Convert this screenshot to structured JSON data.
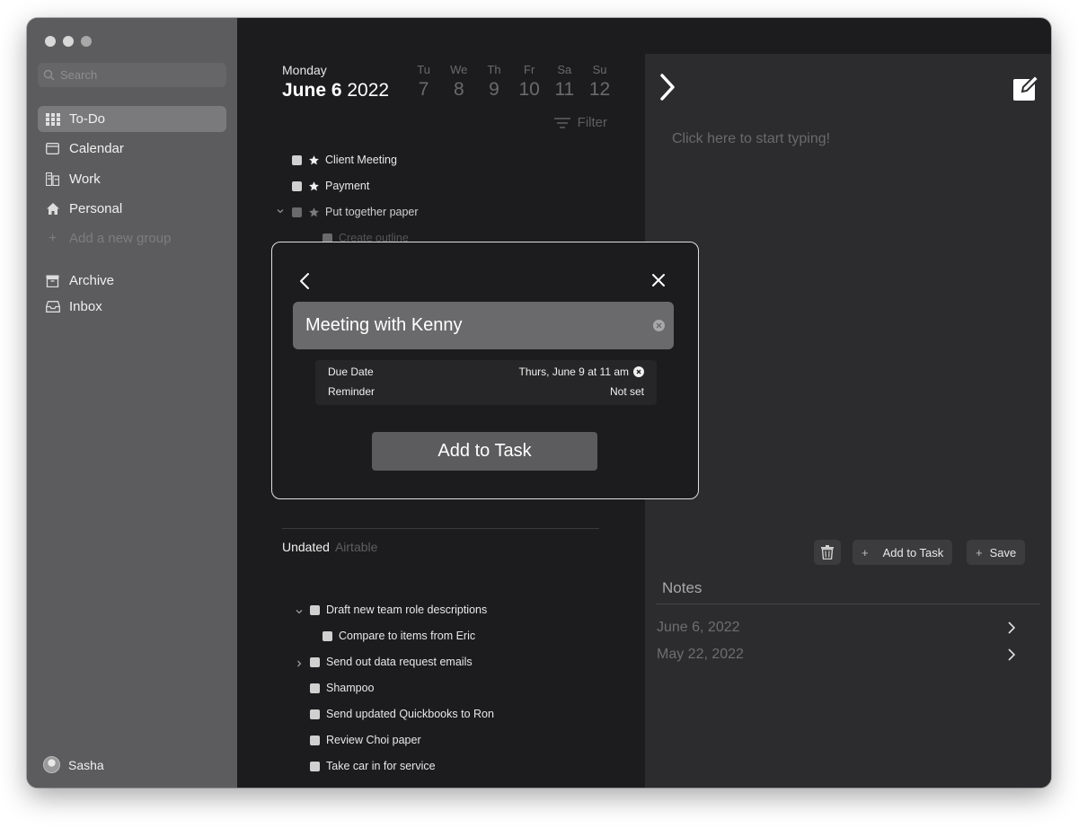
{
  "sidebar": {
    "search_placeholder": "Search",
    "items": [
      {
        "label": "To-Do"
      },
      {
        "label": "Calendar"
      },
      {
        "label": "Work"
      },
      {
        "label": "Personal"
      },
      {
        "label": "Add a new group"
      },
      {
        "label": "Archive"
      },
      {
        "label": "Inbox"
      }
    ],
    "user": "Sasha"
  },
  "header": {
    "day_name": "Monday",
    "date_bold": "June 6",
    "year": "2022",
    "week": [
      {
        "w": "Tu",
        "n": "7"
      },
      {
        "w": "We",
        "n": "8"
      },
      {
        "w": "Th",
        "n": "9"
      },
      {
        "w": "Fr",
        "n": "10"
      },
      {
        "w": "Sa",
        "n": "11"
      },
      {
        "w": "Su",
        "n": "12"
      }
    ],
    "filter_label": "Filter"
  },
  "tasks": {
    "dated": [
      {
        "label": "Client Meeting"
      },
      {
        "label": "Payment"
      },
      {
        "label": "Put together paper"
      },
      {
        "label": "Create outline"
      }
    ],
    "undated_title": "Undated",
    "undated_sub": "Airtable",
    "undated": [
      {
        "label": "Draft new team role descriptions"
      },
      {
        "label": "Compare to items from Eric"
      },
      {
        "label": "Send out data request emails"
      },
      {
        "label": "Shampoo"
      },
      {
        "label": "Send updated Quickbooks to Ron"
      },
      {
        "label": "Review Choi paper"
      },
      {
        "label": "Take car in for service"
      }
    ]
  },
  "editor": {
    "placeholder": "Click here to start typing!",
    "add_to_task_label": "Add to Task",
    "save_label": "Save",
    "notes_title": "Notes",
    "notes": [
      {
        "date": "June 6, 2022"
      },
      {
        "date": "May 22, 2022"
      }
    ]
  },
  "modal": {
    "task_name": "Meeting with Kenny",
    "due_date_label": "Due Date",
    "due_date_value": "Thurs, June 9 at 11 am",
    "reminder_label": "Reminder",
    "reminder_value": "Not set",
    "button_label": "Add to Task"
  }
}
